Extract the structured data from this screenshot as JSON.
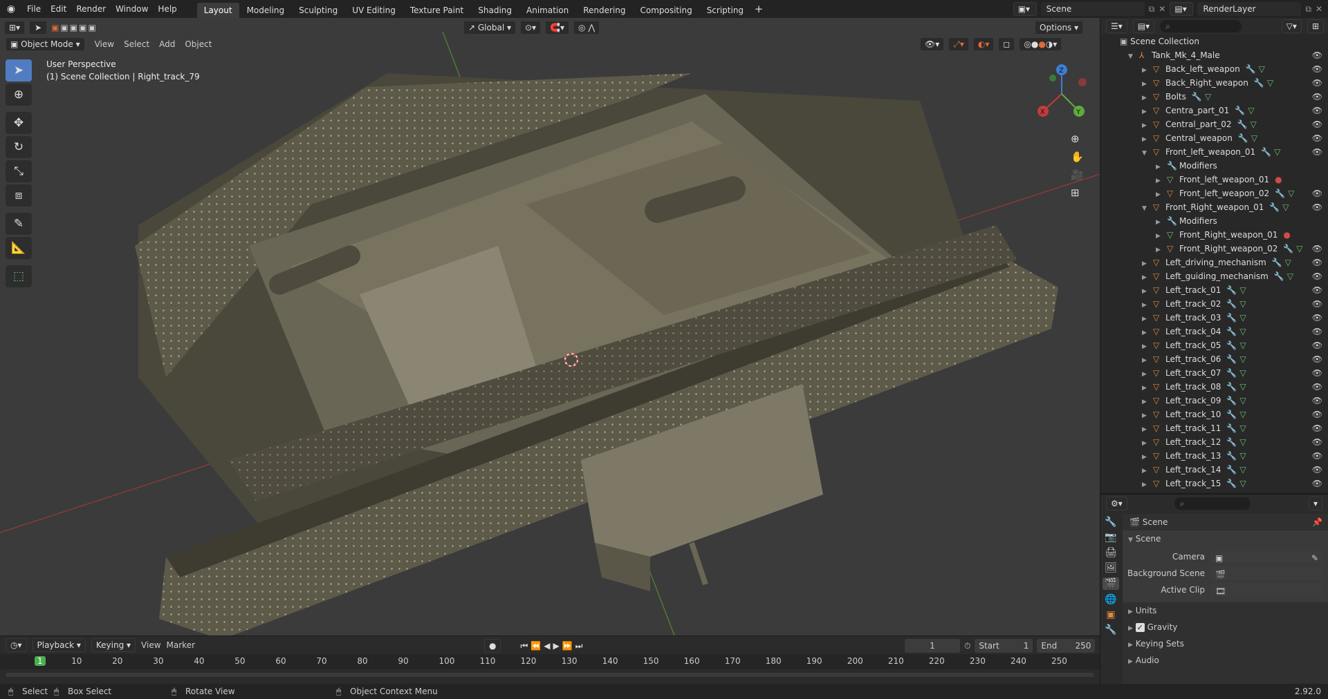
{
  "menu": {
    "items": [
      "File",
      "Edit",
      "Render",
      "Window",
      "Help"
    ]
  },
  "workspaces": [
    "Layout",
    "Modeling",
    "Sculpting",
    "UV Editing",
    "Texture Paint",
    "Shading",
    "Animation",
    "Rendering",
    "Compositing",
    "Scripting"
  ],
  "active_workspace": "Layout",
  "topright": {
    "scene": "Scene",
    "render_layer": "RenderLayer"
  },
  "viewport_header": {
    "mode": "Object Mode",
    "view": "View",
    "select": "Select",
    "add": "Add",
    "object": "Object",
    "orientation": "Global",
    "options": "Options"
  },
  "viewport_info": {
    "line1": "User Perspective",
    "line2": "(1) Scene Collection | Right_track_79"
  },
  "gizmo": {
    "x": "X",
    "y": "Y",
    "z": "Z"
  },
  "outliner": {
    "root": "Scene Collection",
    "rows": [
      {
        "label": "Tank_Mk_4_Male",
        "indent": 1,
        "expanded": true,
        "type": "empty"
      },
      {
        "label": "Back_left_weapon",
        "indent": 2,
        "type": "mesh"
      },
      {
        "label": "Back_Right_weapon",
        "indent": 2,
        "type": "mesh"
      },
      {
        "label": "Bolts",
        "indent": 2,
        "type": "mesh"
      },
      {
        "label": "Centra_part_01",
        "indent": 2,
        "type": "mesh"
      },
      {
        "label": "Central_part_02",
        "indent": 2,
        "type": "mesh"
      },
      {
        "label": "Central_weapon",
        "indent": 2,
        "type": "mesh"
      },
      {
        "label": "Front_left_weapon_01",
        "indent": 2,
        "expanded": true,
        "type": "mesh"
      },
      {
        "label": "Modifiers",
        "indent": 3,
        "type": "mod"
      },
      {
        "label": "Front_left_weapon_01",
        "indent": 3,
        "type": "data"
      },
      {
        "label": "Front_left_weapon_02",
        "indent": 3,
        "type": "mesh"
      },
      {
        "label": "Front_Right_weapon_01",
        "indent": 2,
        "expanded": true,
        "type": "mesh"
      },
      {
        "label": "Modifiers",
        "indent": 3,
        "type": "mod"
      },
      {
        "label": "Front_Right_weapon_01",
        "indent": 3,
        "type": "data"
      },
      {
        "label": "Front_Right_weapon_02",
        "indent": 3,
        "type": "mesh"
      },
      {
        "label": "Left_driving_mechanism",
        "indent": 2,
        "type": "mesh"
      },
      {
        "label": "Left_guiding_mechanism",
        "indent": 2,
        "type": "mesh"
      },
      {
        "label": "Left_track_01",
        "indent": 2,
        "type": "mesh"
      },
      {
        "label": "Left_track_02",
        "indent": 2,
        "type": "mesh"
      },
      {
        "label": "Left_track_03",
        "indent": 2,
        "type": "mesh"
      },
      {
        "label": "Left_track_04",
        "indent": 2,
        "type": "mesh"
      },
      {
        "label": "Left_track_05",
        "indent": 2,
        "type": "mesh"
      },
      {
        "label": "Left_track_06",
        "indent": 2,
        "type": "mesh"
      },
      {
        "label": "Left_track_07",
        "indent": 2,
        "type": "mesh"
      },
      {
        "label": "Left_track_08",
        "indent": 2,
        "type": "mesh"
      },
      {
        "label": "Left_track_09",
        "indent": 2,
        "type": "mesh"
      },
      {
        "label": "Left_track_10",
        "indent": 2,
        "type": "mesh"
      },
      {
        "label": "Left_track_11",
        "indent": 2,
        "type": "mesh"
      },
      {
        "label": "Left_track_12",
        "indent": 2,
        "type": "mesh"
      },
      {
        "label": "Left_track_13",
        "indent": 2,
        "type": "mesh"
      },
      {
        "label": "Left_track_14",
        "indent": 2,
        "type": "mesh"
      },
      {
        "label": "Left_track_15",
        "indent": 2,
        "type": "mesh"
      }
    ]
  },
  "properties": {
    "header": "Scene",
    "panel": "Scene",
    "camera_label": "Camera",
    "background_label": "Background Scene",
    "clip_label": "Active Clip",
    "units": "Units",
    "gravity": "Gravity",
    "keying_sets": "Keying Sets",
    "audio": "Audio",
    "gravity_checked": true
  },
  "timeline": {
    "playback": "Playback",
    "keying": "Keying",
    "view": "View",
    "marker": "Marker",
    "current_frame": "1",
    "start_label": "Start",
    "start": "1",
    "end_label": "End",
    "end": "250",
    "ticks": [
      "1",
      "10",
      "20",
      "30",
      "40",
      "50",
      "60",
      "70",
      "80",
      "90",
      "100",
      "110",
      "120",
      "130",
      "140",
      "150",
      "160",
      "170",
      "180",
      "190",
      "200",
      "210",
      "220",
      "230",
      "240",
      "250"
    ]
  },
  "status": {
    "select": "Select",
    "box_select": "Box Select",
    "rotate": "Rotate View",
    "context": "Object Context Menu",
    "version": "2.92.0"
  },
  "colors": {
    "accent": "#527cc2",
    "active_tab": "#3d3d3d",
    "frame_marker": "#4caf50",
    "x_axis": "#c43c3c",
    "y_axis": "#5faa3c",
    "z_axis": "#3c7fd4"
  }
}
